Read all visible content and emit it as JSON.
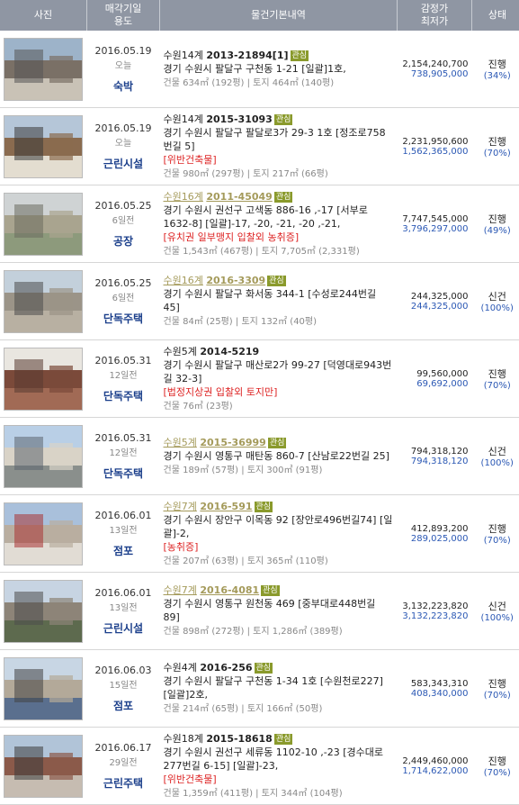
{
  "header": {
    "photo": "사진",
    "date_line1": "매각기일",
    "date_line2": "용도",
    "info": "물건기본내역",
    "price_line1": "감정가",
    "price_line2": "최저가",
    "status": "상태"
  },
  "rows": [
    {
      "date": "2016.05.19",
      "ago": "오늘",
      "use": "숙박",
      "court": "수원14계",
      "case": "2013-21894[1]",
      "visited": false,
      "badge": "관심",
      "addr": "경기 수원시 팔달구 구천동 1-21 [일괄]1호,",
      "warn": "",
      "building": "건물 634㎡ (192평)",
      "land": "토지 464㎡ (140평)",
      "appraisal": "2,154,240,700",
      "min": "738,905,000",
      "status": "진행",
      "pct": "(34%)"
    },
    {
      "date": "2016.05.19",
      "ago": "오늘",
      "use": "근린시설",
      "court": "수원14계",
      "case": "2015-31093",
      "visited": false,
      "badge": "관심",
      "addr": "경기 수원시 팔달구 팔달로3가 29-3 1호 [정조로758번길 5]",
      "warn": "[위반건축물]",
      "building": "건물 980㎡ (297평)",
      "land": "토지 217㎡ (66평)",
      "appraisal": "2,231,950,600",
      "min": "1,562,365,000",
      "status": "진행",
      "pct": "(70%)"
    },
    {
      "date": "2016.05.25",
      "ago": "6일전",
      "use": "공장",
      "court": "수원16계",
      "case": "2011-45049",
      "visited": true,
      "badge": "관심",
      "addr": "경기 수원시 권선구 고색동 886-16 ,-17 [서부로1632-8] [일괄]-17, -20, -21, -20 ,-21,",
      "warn": "[유치권  일부맹지 입찰외  농취증]",
      "building": "건물 1,543㎡ (467평)",
      "land": "토지 7,705㎡ (2,331평)",
      "appraisal": "7,747,545,000",
      "min": "3,796,297,000",
      "status": "진행",
      "pct": "(49%)"
    },
    {
      "date": "2016.05.25",
      "ago": "6일전",
      "use": "단독주택",
      "court": "수원16계",
      "case": "2016-3309",
      "visited": true,
      "badge": "관심",
      "addr": "경기 수원시 팔달구 화서동 344-1 [수성로244번길 45]",
      "warn": "",
      "building": "건물 84㎡ (25평)",
      "land": "토지 132㎡ (40평)",
      "appraisal": "244,325,000",
      "min": "244,325,000",
      "status": "신건",
      "pct": "(100%)"
    },
    {
      "date": "2016.05.31",
      "ago": "12일전",
      "use": "단독주택",
      "court": "수원5계",
      "case": "2014-5219",
      "visited": false,
      "badge": "",
      "addr": "경기 수원시 팔달구 매산로2가 99-27 [덕영대로943번길 32-3]",
      "warn": "[법정지상권  입찰외  토지만]",
      "building": "건물 76㎡ (23평)",
      "land": "",
      "appraisal": "99,560,000",
      "min": "69,692,000",
      "status": "진행",
      "pct": "(70%)"
    },
    {
      "date": "2016.05.31",
      "ago": "12일전",
      "use": "단독주택",
      "court": "수원5계",
      "case": "2015-36999",
      "visited": true,
      "badge": "관심",
      "addr": "경기 수원시 영통구 매탄동 860-7 [산남로22번길 25]",
      "warn": "",
      "building": "건물 189㎡ (57평)",
      "land": "토지 300㎡ (91평)",
      "appraisal": "794,318,120",
      "min": "794,318,120",
      "status": "신건",
      "pct": "(100%)"
    },
    {
      "date": "2016.06.01",
      "ago": "13일전",
      "use": "점포",
      "court": "수원7계",
      "case": "2016-591",
      "visited": true,
      "badge": "관심",
      "addr": "경기 수원시 장안구 이목동 92 [장안로496번길74] [일괄]-2,",
      "warn": "[농취증]",
      "building": "건물 207㎡ (63평)",
      "land": "토지 365㎡ (110평)",
      "appraisal": "412,893,200",
      "min": "289,025,000",
      "status": "진행",
      "pct": "(70%)"
    },
    {
      "date": "2016.06.01",
      "ago": "13일전",
      "use": "근린시설",
      "court": "수원7계",
      "case": "2016-4081",
      "visited": true,
      "badge": "관심",
      "addr": "경기 수원시 영통구 원천동 469 [중부대로448번길 89]",
      "warn": "",
      "building": "건물 898㎡ (272평)",
      "land": "토지 1,286㎡ (389평)",
      "appraisal": "3,132,223,820",
      "min": "3,132,223,820",
      "status": "신건",
      "pct": "(100%)"
    },
    {
      "date": "2016.06.03",
      "ago": "15일전",
      "use": "점포",
      "court": "수원4계",
      "case": "2016-256",
      "visited": false,
      "badge": "관심",
      "addr": "경기 수원시 팔달구 구천동 1-34 1호 [수원천로227] [일괄]2호,",
      "warn": "",
      "building": "건물 214㎡ (65평)",
      "land": "토지 166㎡ (50평)",
      "appraisal": "583,343,310",
      "min": "408,340,000",
      "status": "진행",
      "pct": "(70%)"
    },
    {
      "date": "2016.06.17",
      "ago": "29일전",
      "use": "근린주택",
      "court": "수원18계",
      "case": "2015-18618",
      "visited": false,
      "badge": "관심",
      "addr": "경기 수원시 권선구 세류동 1102-10 ,-23 [경수대로277번길 6-15] [일괄]-23,",
      "warn": "[위반건축물]",
      "building": "건물 1,359㎡ (411평)",
      "land": "토지 344㎡ (104평)",
      "appraisal": "2,449,460,000",
      "min": "1,714,622,000",
      "status": "진행",
      "pct": "(70%)"
    }
  ]
}
